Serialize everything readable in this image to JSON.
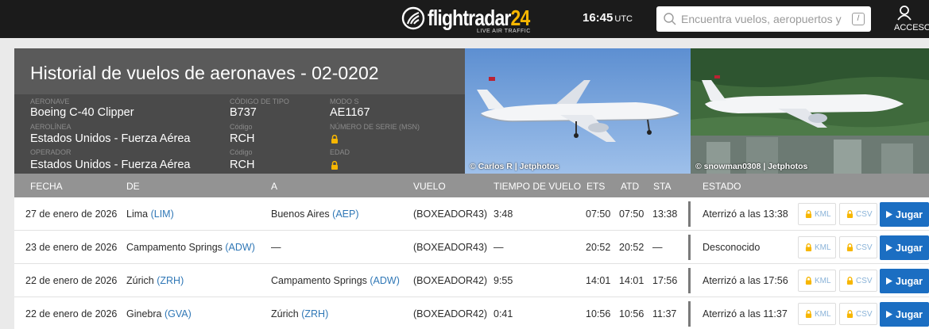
{
  "nav": {
    "logo_main": "flightradar",
    "logo_num": "24",
    "logo_sub": "LIVE AIR TRAFFIC",
    "time": "16:45",
    "time_zone": "UTC",
    "search_placeholder": "Encuentra vuelos, aeropuertos y",
    "search_shortcut": "/",
    "account_label": "ACCESO"
  },
  "aircraft": {
    "title": "Historial de vuelos de aeronaves - 02-0202",
    "aircraft_label": "AERONAVE",
    "aircraft_value": "Boeing C-40 Clipper",
    "type_code_label": "CÓDIGO DE TIPO",
    "type_code_value": "B737",
    "mode_s_label": "MODO S",
    "mode_s_value": "AE1167",
    "airline_label": "AEROLÍNEA",
    "airline_value": "Estados Unidos - Fuerza Aérea",
    "airline_code_label": "Código",
    "airline_code_value": "RCH",
    "msn_label": "NÚMERO DE SERIE (MSN)",
    "operator_label": "OPERADOR",
    "operator_value": "Estados Unidos - Fuerza Aérea",
    "operator_code_label": "Código",
    "operator_code_value": "RCH",
    "age_label": "EDAD"
  },
  "photos": [
    {
      "credit": "© Carlos R | Jetphotos"
    },
    {
      "credit": "© snowman0308 | Jetphotos"
    }
  ],
  "table": {
    "headers": {
      "date": "FECHA",
      "from": "DE",
      "to": "A",
      "flight": "VUELO",
      "flight_time": "TIEMPO DE VUELO",
      "ets": "ETS",
      "atd": "ATD",
      "sta": "STA",
      "status": "ESTADO"
    },
    "kml_label": "KML",
    "csv_label": "CSV",
    "play_label": "Jugar",
    "rows": [
      {
        "date": "27 de enero de 2026",
        "from": "Lima",
        "from_code": "(LIM)",
        "to": "Buenos Aires",
        "to_code": "(AEP)",
        "flight": "(BOXEADOR43)",
        "flight_time": "3:48",
        "ets": "07:50",
        "atd": "07:50",
        "sta": "13:38",
        "status": "Aterrizó a las 13:38"
      },
      {
        "date": "23 de enero de 2026",
        "from": "Campamento Springs",
        "from_code": "(ADW)",
        "to": "—",
        "to_code": "",
        "flight": "(BOXEADOR43)",
        "flight_time": "—",
        "ets": "20:52",
        "atd": "20:52",
        "sta": "—",
        "status": "Desconocido"
      },
      {
        "date": "22 de enero de 2026",
        "from": "Zúrich",
        "from_code": "(ZRH)",
        "to": "Campamento Springs",
        "to_code": "(ADW)",
        "flight": "(BOXEADOR42)",
        "flight_time": "9:55",
        "ets": "14:01",
        "atd": "14:01",
        "sta": "17:56",
        "status": "Aterrizó a las 17:56"
      },
      {
        "date": "22 de enero de 2026",
        "from": "Ginebra",
        "from_code": "(GVA)",
        "to": "Zúrich",
        "to_code": "(ZRH)",
        "flight": "(BOXEADOR42)",
        "flight_time": "0:41",
        "ets": "10:56",
        "atd": "10:56",
        "sta": "11:37",
        "status": "Aterrizó a las 11:37"
      }
    ]
  },
  "colors": {
    "nav_bg": "#1b1b1b",
    "accent_yellow": "#f7b600",
    "link_blue": "#2f77b6",
    "play_blue": "#1b6ec2",
    "table_header": "#939393"
  }
}
